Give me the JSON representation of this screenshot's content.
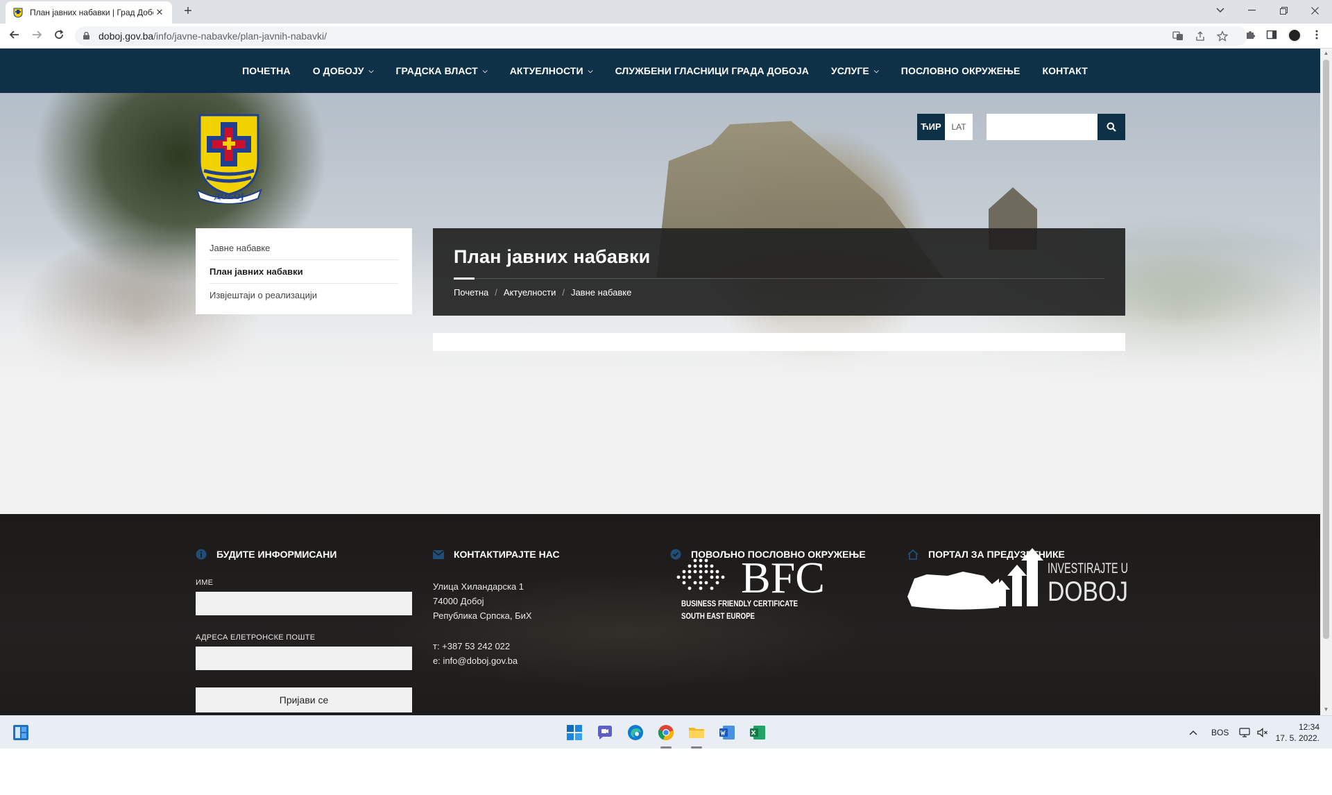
{
  "browser": {
    "tab_title": "План јавних набавки | Град Добој",
    "tab_close": "✕",
    "new_tab": "+",
    "url_host": "doboj.gov.ba",
    "url_path": "/info/javne-nabavke/plan-javnih-nabavki/"
  },
  "nav": {
    "items": [
      {
        "label": "ПОЧЕТНА",
        "dropdown": false
      },
      {
        "label": "О ДОБОЈУ",
        "dropdown": true
      },
      {
        "label": "ГРАДСКА ВЛАСТ",
        "dropdown": true
      },
      {
        "label": "АКТУЕЛНОСТИ",
        "dropdown": true
      },
      {
        "label": "СЛУЖБЕНИ ГЛАСНИЦИ ГРАДА ДОБОЈА",
        "dropdown": false
      },
      {
        "label": "УСЛУГЕ",
        "dropdown": true
      },
      {
        "label": "ПОСЛОВНО ОКРУЖЕЊЕ",
        "dropdown": false
      },
      {
        "label": "КОНТАКТ",
        "dropdown": false
      }
    ]
  },
  "lang": {
    "cyr": "ЋИР",
    "lat": "LAT"
  },
  "search": {
    "placeholder": ""
  },
  "logo_text": "ДОБОЈ",
  "sidebar": {
    "items": [
      {
        "label": "Јавне набавке"
      },
      {
        "label": "План јавних набавки"
      },
      {
        "label": "Извјештаји о реализацији"
      }
    ]
  },
  "page": {
    "title": "План јавних набавки",
    "breadcrumb": [
      "Почетна",
      "Актуелности",
      "Јавне набавке"
    ],
    "breadcrumb_sep": "/"
  },
  "footer": {
    "newsletter": {
      "heading": "БУДИТЕ ИНФОРМИСАНИ",
      "name_label": "ИМЕ",
      "email_label": "АДРЕСА ЕЛЕТРОНСКЕ ПОШТЕ",
      "submit_label": "Пријави се"
    },
    "contact": {
      "heading": "КОНТАКТИРАЈТЕ НАС",
      "street": "Улица Хиландарска 1",
      "city": "74000 Добој",
      "country": "Република Српска, БиХ",
      "phone": "т: +387 53 242 022",
      "email": "е: info@doboj.gov.ba"
    },
    "business": {
      "heading": "ПОВОЉНО ПОСЛОВНО ОКРУЖЕЊЕ",
      "bfc_mark": "BFC",
      "bfc_line1": "BUSINESS FRIENDLY CERTIFICATE",
      "bfc_line2": "SOUTH EAST EUROPE"
    },
    "portal": {
      "heading": "ПОРТАЛ ЗА ПРЕДУЗЕТНИКЕ",
      "logo_line1": "INVESTIRAJTE U",
      "logo_line2": "DOBOJ"
    }
  },
  "taskbar": {
    "lang": "BOS",
    "time": "12:34",
    "date": "17. 5. 2022."
  },
  "colors": {
    "nav_bg": "#0f3147",
    "footer_bg": "#1e1c1b",
    "title_panel": "#222222",
    "footer_icon": "#1f4e79"
  }
}
